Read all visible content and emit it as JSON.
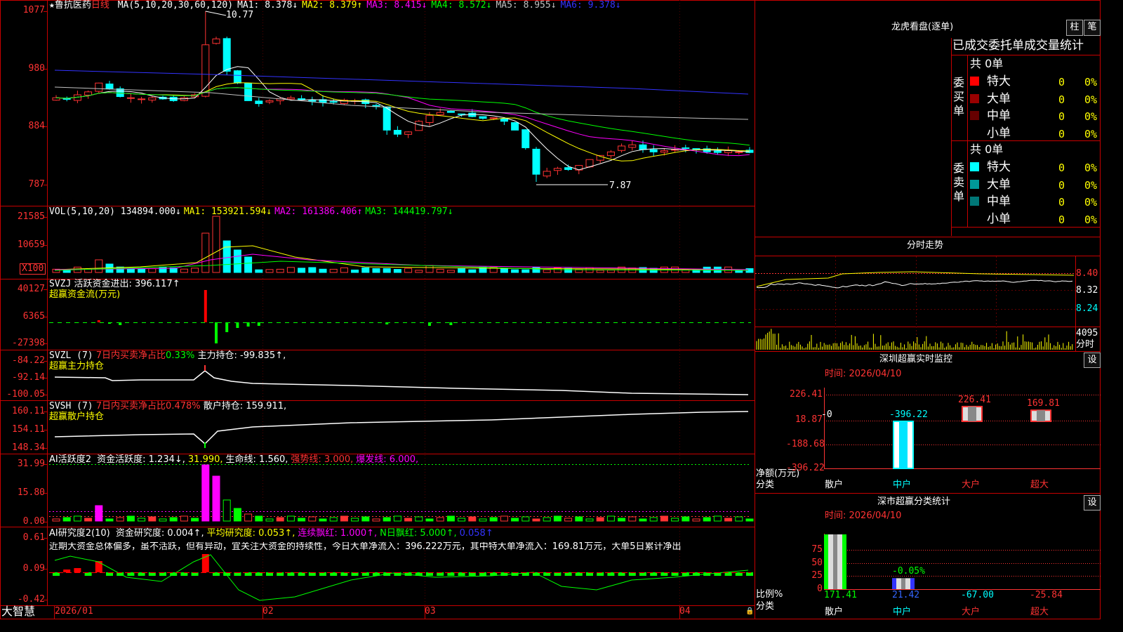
{
  "stock": {
    "name": "鲁抗医药",
    "period": "日线",
    "star": "★"
  },
  "main_panel": {
    "ma_params": "MA(5,10,20,30,60,120)",
    "ma": [
      {
        "label": "MA1:",
        "value": "8.378↓",
        "color": "#ffffff"
      },
      {
        "label": "MA2:",
        "value": "8.379↑",
        "color": "#ffff00"
      },
      {
        "label": "MA3:",
        "value": "8.415↓",
        "color": "#ff00ff"
      },
      {
        "label": "MA4:",
        "value": "8.572↓",
        "color": "#00ff00"
      },
      {
        "label": "MA5:",
        "value": "8.955↓",
        "color": "#c0c0c0"
      },
      {
        "label": "MA6:",
        "value": "9.378↓",
        "color": "#3333ff"
      }
    ],
    "axis": [
      "1077",
      "980",
      "884",
      "787"
    ],
    "high_mark": "10.77",
    "low_mark": "7.87"
  },
  "vol_panel": {
    "title": "VOL(5,10,20)",
    "value": "134894.000↓",
    "ma": [
      {
        "text": "MA1: 153921.594↓",
        "color": "#ffff00"
      },
      {
        "text": "MA2: 161386.406↑",
        "color": "#ff00ff"
      },
      {
        "text": "MA3: 144419.797↓",
        "color": "#00ff00"
      }
    ],
    "axis": [
      "21585",
      "10659"
    ],
    "unit": "X100"
  },
  "svzj_panel": {
    "title": "SVZJ",
    "line1": "活跃资金进出: 396.117↑",
    "line2": "超赢资金流(万元)",
    "axis": [
      "40127",
      "6365",
      "-27398"
    ]
  },
  "svzl_panel": {
    "title": "SVZL (7)",
    "ratio_label": "7日内买卖净占比",
    "ratio_value": "0.33%",
    "holding": "主力持仓: -99.835↑,",
    "subtitle": "超赢主力持仓",
    "axis": [
      "-84.22",
      "-92.14",
      "-100.05"
    ]
  },
  "svsh_panel": {
    "title": "SVSH (7)",
    "ratio_label": "7日内买卖净占比",
    "ratio_value": "0.478%",
    "holding": "散户持仓: 159.911,",
    "subtitle": "超赢散户持仓",
    "axis": [
      "160.11",
      "154.11",
      "148.34"
    ]
  },
  "ai_active_panel": {
    "title": "AI活跃度2",
    "items": [
      {
        "text": "资金活跃度: 1.234↓,",
        "color": "#ffffff"
      },
      {
        "text": "31.990,",
        "color": "#ffff00"
      },
      {
        "text": "生命线: 1.560,",
        "color": "#ffffff"
      },
      {
        "text": "强势线: 3.000,",
        "color": "#ff3333"
      },
      {
        "text": "爆发线: 6.000,",
        "color": "#ff00ff"
      }
    ],
    "axis": [
      "31.99",
      "15.80",
      "0.00"
    ]
  },
  "ai_research_panel": {
    "title": "AI研究度2(10)",
    "items": [
      {
        "text": "资金研究度: 0.004↑,",
        "color": "#ffffff"
      },
      {
        "text": "平均研究度: 0.053↑,",
        "color": "#ffff00"
      },
      {
        "text": "连续飘红: 1.000↑,",
        "color": "#ff00ff"
      },
      {
        "text": "N日飘红: 5.000↑,",
        "color": "#00ff00"
      },
      {
        "text": "0.058↑",
        "color": "#3333ff"
      }
    ],
    "comment": "近期大资金总体偏多，虽不活跃，但有异动，宜关注大资金的持续性，今日大单净流入：396.222万元，其中特大单净流入：169.81万元，大单5日累计净出",
    "axis": [
      "0.61",
      "0.09",
      "-0.42"
    ]
  },
  "date_axis": {
    "brand": "大智慧",
    "labels": [
      "2026/01",
      "02",
      "03",
      "04"
    ]
  },
  "dragon_tiger": {
    "title": "龙虎看盘(逐单)",
    "btn_bar": "柱",
    "btn_tick": "笔",
    "subtitle": "已成交委托单成交量统计",
    "buy": {
      "side_label": "委买单",
      "total": "共 0单",
      "rows": [
        {
          "name": "特大",
          "count": "0",
          "pct": "0%",
          "color": "#ff0000"
        },
        {
          "name": "大单",
          "count": "0",
          "pct": "0%",
          "color": "#990000"
        },
        {
          "name": "中单",
          "count": "0",
          "pct": "0%",
          "color": "#660000"
        },
        {
          "name": "小单",
          "count": "0",
          "pct": "0%",
          "color": ""
        }
      ]
    },
    "sell": {
      "side_label": "委卖单",
      "total": "共 0单",
      "rows": [
        {
          "name": "特大",
          "count": "0",
          "pct": "0%",
          "color": "#00ffff"
        },
        {
          "name": "大单",
          "count": "0",
          "pct": "0%",
          "color": "#009999"
        },
        {
          "name": "中单",
          "count": "0",
          "pct": "0%",
          "color": "#007777"
        },
        {
          "name": "小单",
          "count": "0",
          "pct": "0%",
          "color": ""
        }
      ]
    }
  },
  "intraday": {
    "title": "分时走势",
    "axis": [
      {
        "v": "8.40",
        "color": "#ff3333"
      },
      {
        "v": "8.32",
        "color": "#ffffff"
      },
      {
        "v": "8.24",
        "color": "#00ffff"
      }
    ],
    "vol_value": "4095",
    "vol_unit": "分时"
  },
  "sz_monitor": {
    "title": "深圳超赢实时监控",
    "btn": "设",
    "date": "时间: 2026/04/10",
    "axis": [
      "226.41",
      "18.87",
      "-188.68",
      "-396.22"
    ],
    "ylabel": "净额(万元)",
    "xlabel": "分类",
    "bars": [
      {
        "cat": "散户",
        "value": 0,
        "label": "-0",
        "cat_color": "#ffffff"
      },
      {
        "cat": "中户",
        "value": -396.22,
        "label": "-396.22",
        "cat_color": "#00ffff"
      },
      {
        "cat": "大户",
        "value": 226.41,
        "label": "226.41",
        "cat_color": "#ff3333"
      },
      {
        "cat": "超大",
        "value": 169.81,
        "label": "169.81",
        "cat_color": "#ff3333"
      }
    ]
  },
  "sz_category": {
    "title": "深市超赢分类统计",
    "btn": "设",
    "date": "时间: 2026/04/10",
    "axis": [
      "75",
      "50",
      "25",
      "0"
    ],
    "ylabel": "比例%",
    "xlabel": "分类",
    "bars": [
      {
        "cat": "散户",
        "value": 171.41,
        "pct": 100,
        "label": "171.41",
        "cat_color": "#ffffff",
        "val_color": "#00ff00"
      },
      {
        "cat": "中户",
        "value": 21.42,
        "pct": 20,
        "label": "21.42",
        "cat_color": "#00ffff",
        "val_color": "#3366ff",
        "note": "-0.05%"
      },
      {
        "cat": "大户",
        "value": -67.0,
        "pct": 0,
        "label": "-67.00",
        "cat_color": "#ff3333",
        "val_color": "#00ffff"
      },
      {
        "cat": "超大",
        "value": -25.84,
        "pct": 0,
        "label": "-25.84",
        "cat_color": "#ff3333",
        "val_color": "#ff3333"
      }
    ]
  }
}
